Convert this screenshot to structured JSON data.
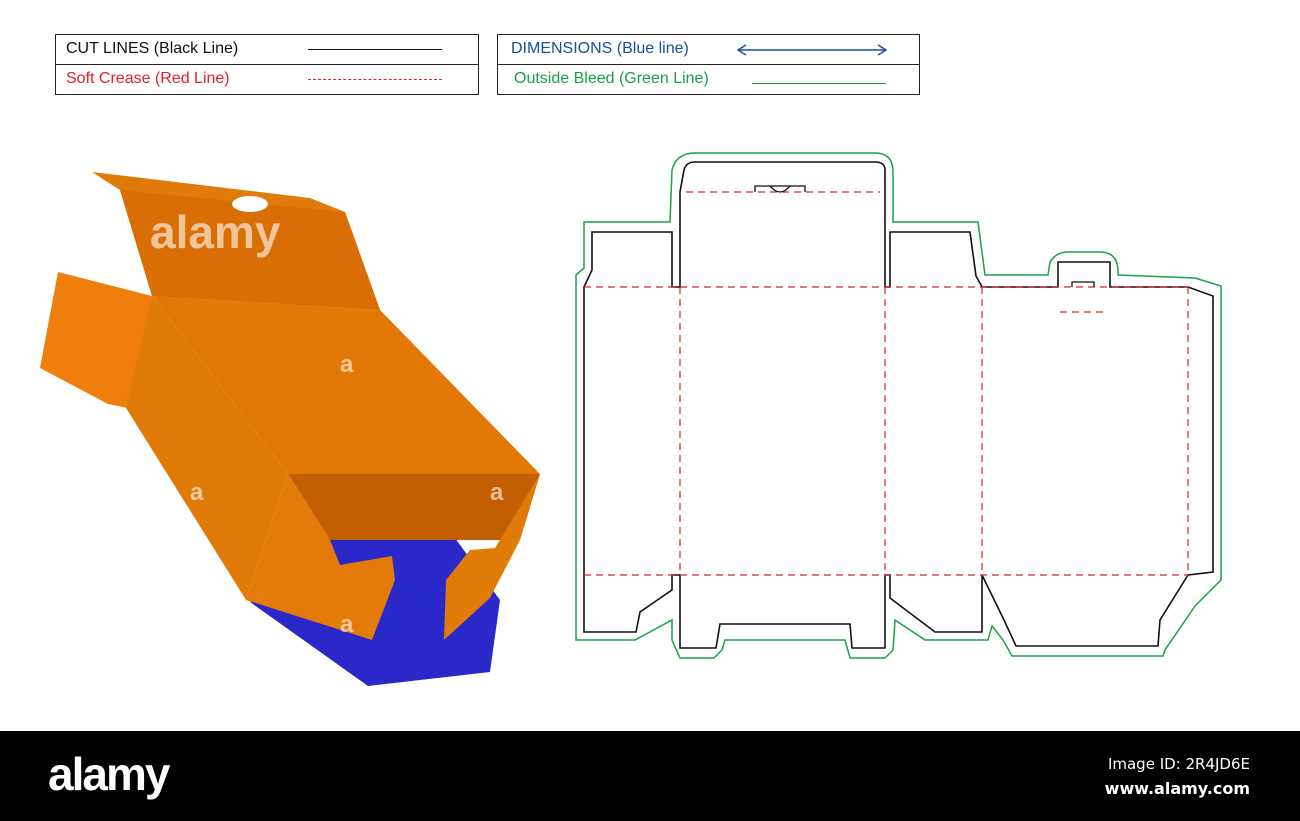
{
  "legend": {
    "cut_lines": "CUT LINES (Black Line)",
    "soft_crease": "Soft Crease (Red Line)",
    "dimensions": "DIMENSIONS (Blue line)",
    "outside_bleed": "Outside Bleed (Green Line)"
  },
  "colors": {
    "cut": "#111111",
    "crease": "#e0202a",
    "dimension": "#1a4f9c",
    "bleed": "#1aa04a",
    "box_orange": "#e67c0a",
    "box_blue": "#2a28c8"
  },
  "watermark": {
    "text": "alamy",
    "small": "a"
  },
  "footer": {
    "logo": "alamy",
    "image_id": "Image ID: 2R4JD6E",
    "url": "www.alamy.com"
  }
}
